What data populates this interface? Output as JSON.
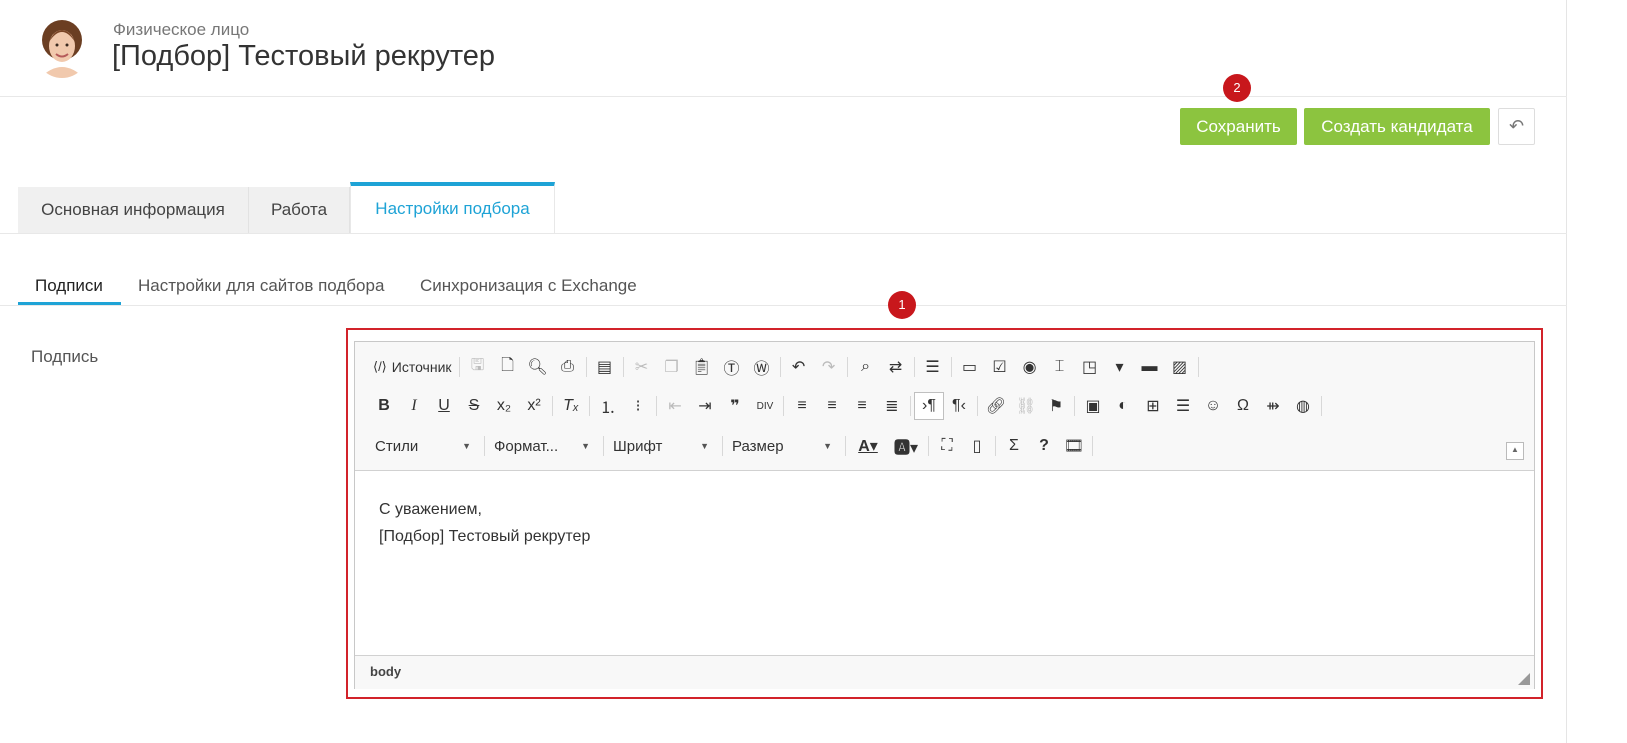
{
  "header": {
    "subtitle": "Физическое лицо",
    "title": "[Подбор] Тестовый рекрутер"
  },
  "markers": [
    "1",
    "2"
  ],
  "actions": {
    "save": "Сохранить",
    "create_candidate": "Создать кандидата"
  },
  "tabs": [
    "Основная информация",
    "Работа",
    "Настройки подбора"
  ],
  "active_tab": "Настройки подбора",
  "subtabs": [
    "Подписи",
    "Настройки для сайтов подбора",
    "Синхронизация с Exchange"
  ],
  "active_subtab": "Подписи",
  "field": {
    "label": "Подпись"
  },
  "editor": {
    "source_label": "Источник",
    "combos": [
      "Стили",
      "Формат...",
      "Шрифт",
      "Размер"
    ],
    "content_lines": [
      "С уважением,",
      "[Подбор] Тестовый рекрутер"
    ],
    "status_path": "body"
  },
  "colors": {
    "accent": "#1ea3d6",
    "button": "#8cc43f",
    "marker": "#c8171c"
  }
}
